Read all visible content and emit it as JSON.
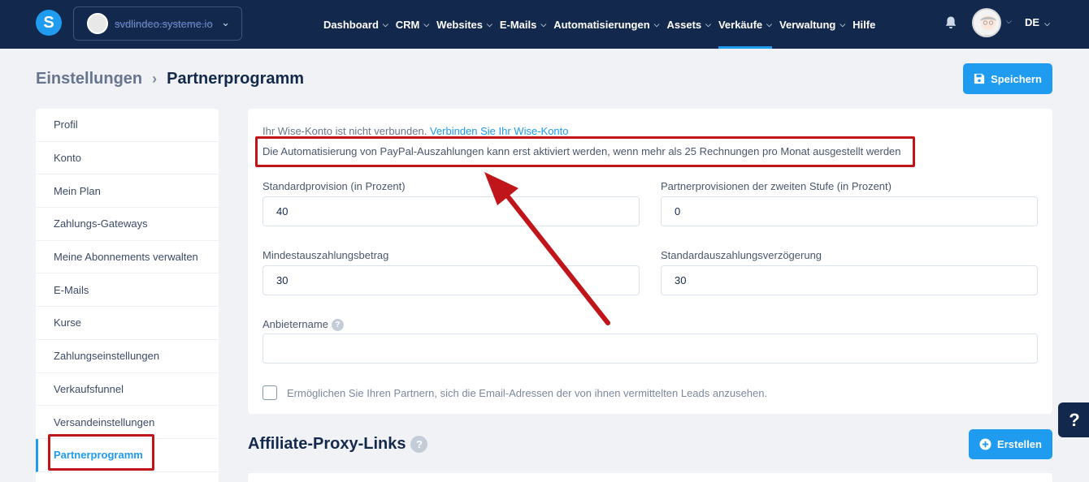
{
  "nav": {
    "logo_letter": "S",
    "account_domain": "svdlindeo.systeme.io",
    "items": [
      {
        "label": "Dashboard",
        "active": false
      },
      {
        "label": "CRM",
        "active": false
      },
      {
        "label": "Websites",
        "active": false
      },
      {
        "label": "E-Mails",
        "active": false
      },
      {
        "label": "Automatisierungen",
        "active": false
      },
      {
        "label": "Assets",
        "active": false
      },
      {
        "label": "Verkäufe",
        "active": true
      },
      {
        "label": "Verwaltung",
        "active": false
      },
      {
        "label": "Hilfe",
        "active": false
      }
    ],
    "language": "DE"
  },
  "header": {
    "breadcrumb_parent": "Einstellungen",
    "breadcrumb_current": "Partnerprogramm",
    "save_label": "Speichern"
  },
  "sidebar": {
    "items": [
      {
        "label": "Profil"
      },
      {
        "label": "Konto"
      },
      {
        "label": "Mein Plan"
      },
      {
        "label": "Zahlungs-Gateways"
      },
      {
        "label": "Meine Abonnements verwalten"
      },
      {
        "label": "E-Mails"
      },
      {
        "label": "Kurse"
      },
      {
        "label": "Zahlungseinstellungen"
      },
      {
        "label": "Verkaufsfunnel"
      },
      {
        "label": "Versandeinstellungen"
      },
      {
        "label": "Partnerprogramm"
      }
    ]
  },
  "form": {
    "wise_text": "Ihr Wise-Konto ist nicht verbunden.",
    "wise_link": "Verbinden Sie Ihr Wise-Konto",
    "paypal_notice": "Die Automatisierung von PayPal-Auszahlungen kann erst aktiviert werden, wenn mehr als 25 Rechnungen pro Monat ausgestellt werden",
    "default_commission_label": "Standardprovision (in Prozent)",
    "default_commission_value": "40",
    "second_tier_label": "Partnerprovisionen der zweiten Stufe (in Prozent)",
    "second_tier_value": "0",
    "min_payout_label": "Mindestauszahlungsbetrag",
    "min_payout_value": "30",
    "payout_delay_label": "Standardauszahlungsverzögerung",
    "payout_delay_value": "30",
    "provider_name_label": "Anbietername",
    "provider_name_value": "",
    "checkbox_label": "Ermöglichen Sie Ihren Partnern, sich die Email-Adressen der von ihnen vermittelten Leads anzusehen.",
    "checkbox_checked": false
  },
  "affiliate": {
    "title": "Affiliate-Proxy-Links",
    "create_label": "Erstellen"
  },
  "help": {
    "symbol": "?",
    "fab_symbol": "?"
  },
  "colors": {
    "nav_bg": "#12284c",
    "accent": "#1f9bf0",
    "annotation_red": "#c0151b"
  }
}
